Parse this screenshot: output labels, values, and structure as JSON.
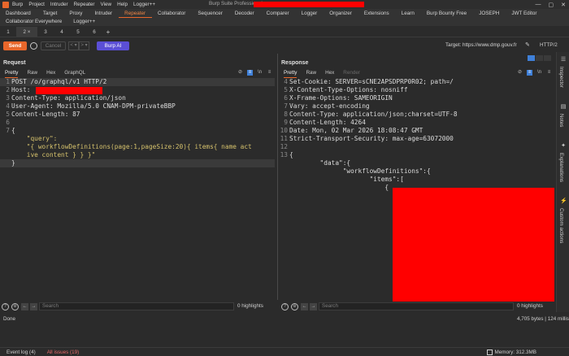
{
  "app": {
    "menu": [
      "Burp",
      "Project",
      "Intruder",
      "Repeater",
      "View",
      "Help",
      "Logger++"
    ],
    "window_title": "Burp Suite Professional v"
  },
  "tabs_row1": [
    "Dashboard",
    "Target",
    "Proxy",
    "Intruder",
    "Repeater",
    "Collaborator",
    "Sequencer",
    "Decoder",
    "Comparer",
    "Logger",
    "Organizer",
    "Extensions",
    "Learn",
    "Burp Bounty Free",
    "JOSEPH",
    "JWT Editor"
  ],
  "tabs_row2": [
    "Collaborator Everywhere",
    "Logger++"
  ],
  "active_tab": "Repeater",
  "subtabs": [
    "1",
    "2 ×",
    "3",
    "4",
    "5",
    "6"
  ],
  "toolbar": {
    "send": "Send",
    "cancel": "Cancel",
    "prev": "< ▾",
    "next": "> ▾",
    "burp_ai": "Burp AI",
    "target": "Target: https://www.dmp.gouv.fr",
    "protocol": "HTTP/2"
  },
  "request": {
    "header": "Request",
    "tabs": [
      "Pretty",
      "Raw",
      "Hex",
      "GraphQL"
    ],
    "lines": [
      {
        "n": "1",
        "t": "POST /o/graphql/v1 HTTP/2"
      },
      {
        "n": "2",
        "t": "Host: "
      },
      {
        "n": "3",
        "t": "Content-Type: application/json"
      },
      {
        "n": "4",
        "t": "User-Agent: Mozilla/5.0 CNAM-DPM-privateBBP"
      },
      {
        "n": "5",
        "t": "Content-Length: 87"
      },
      {
        "n": "6",
        "t": ""
      },
      {
        "n": "7",
        "t": "{"
      },
      {
        "n": "",
        "t": "    \"query\":"
      },
      {
        "n": "",
        "t": "    \"{ workflowDefinitions(page:1,pageSize:20){ items{ name act"
      },
      {
        "n": "",
        "t": "    ive content } } }\""
      },
      {
        "n": "",
        "t": "}"
      }
    ]
  },
  "response": {
    "header": "Response",
    "tabs": [
      "Pretty",
      "Raw",
      "Hex",
      "Render"
    ],
    "lines": [
      {
        "n": "4",
        "t": "Set-Cookie: SERVER=sCNE2APSDPRP0R02; path=/"
      },
      {
        "n": "5",
        "t": "X-Content-Type-Options: nosniff"
      },
      {
        "n": "6",
        "t": "X-Frame-Options: SAMEORIGIN"
      },
      {
        "n": "7",
        "t": "Vary: accept-encoding"
      },
      {
        "n": "8",
        "t": "Content-Type: application/json;charset=UTF-8"
      },
      {
        "n": "9",
        "t": "Content-Length: 4264"
      },
      {
        "n": "10",
        "t": "Date: Mon, 02 Mar 2026 18:08:47 GMT"
      },
      {
        "n": "11",
        "t": "Strict-Transport-Security: max-age=63072000"
      },
      {
        "n": "12",
        "t": ""
      },
      {
        "n": "13",
        "t": "{"
      },
      {
        "n": "",
        "t": "        \"data\":{"
      },
      {
        "n": "",
        "t": "              \"workflowDefinitions\":{"
      },
      {
        "n": "",
        "t": "                     \"items\":["
      },
      {
        "n": "",
        "t": "                         {"
      }
    ]
  },
  "search": {
    "placeholder": "Search",
    "highlights": "0 highlights"
  },
  "sidebar": [
    "Inspector",
    "Notes",
    "Explanations",
    "Custom actions"
  ],
  "status": {
    "done": "Done",
    "bytes": "4,705 bytes | 124 millis"
  },
  "footer": {
    "event_log": "Event log (4)",
    "all_issues": "All issues (19)",
    "memory": "Memory: 312.3MB"
  },
  "colors": {
    "accent": "#e8672b",
    "ai": "#5b4fd6",
    "redaction": "#ff0000"
  }
}
